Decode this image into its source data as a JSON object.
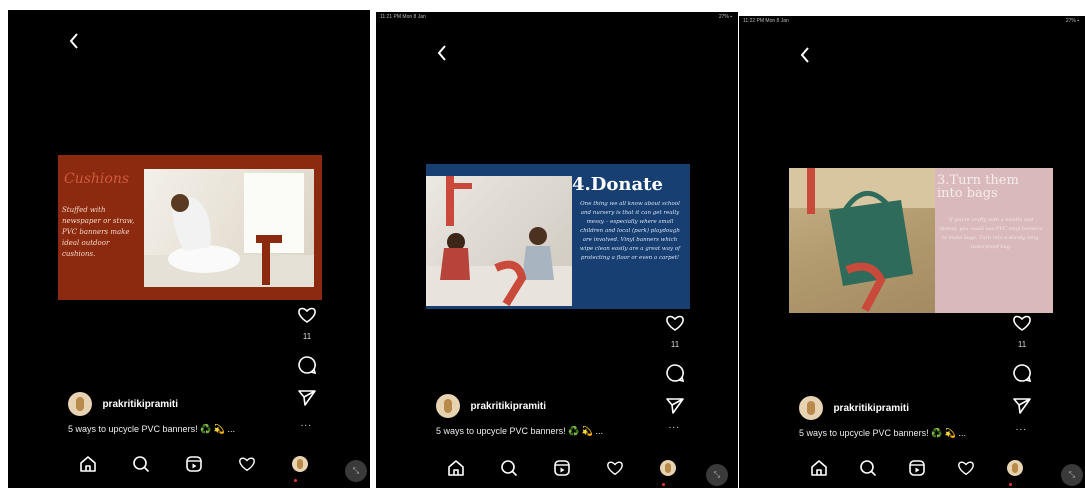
{
  "screens": [
    {
      "status_left": "",
      "status_right": "",
      "slide": {
        "title": "Cushions",
        "text": "Stuffed with newspaper or straw, PVC banners make ideal outdoor cushions."
      },
      "likes": "11",
      "username": "prakritikipramiti",
      "caption": "5 ways to upcycle PVC banners! ♻️ 💫 ...",
      "more": "..."
    },
    {
      "status_left": "11:21 PM  Mon 8 Jan",
      "status_right": "27% ▪",
      "slide": {
        "title": "4.Donate",
        "text": "One thing we all know about school and nursery is that it can get really messy – especially where small children and local (park) playdough are involved. Vinyl banners which wipe clean easily are a great way of protecting a floor or even a carpet!"
      },
      "likes": "11",
      "username": "prakritikipramiti",
      "caption": "5 ways to upcycle PVC banners! ♻️ 💫 ...",
      "more": "..."
    },
    {
      "status_left": "11:22 PM  Mon 8 Jan",
      "status_right": "27% ▪",
      "slide": {
        "title": "3.Turn them into bags",
        "text": "If you're crafty with a needle and thread, you could use PVC vinyl banners to make bags. Turn into a sturdy, long, waterproof bag."
      },
      "likes": "11",
      "username": "prakritikipramiti",
      "caption": "5 ways to upcycle PVC banners! ♻️ 💫 ...",
      "more": "..."
    }
  ],
  "icons": {
    "back": "chevron-left-icon",
    "like": "heart-icon",
    "comment": "comment-bubble-icon",
    "share": "paper-plane-icon",
    "nav": [
      "home-icon",
      "search-icon",
      "reels-icon",
      "activity-heart-icon",
      "profile-avatar"
    ]
  },
  "colors": {
    "background": "#000000",
    "slide1": "#8c2a10",
    "slide2": "#173f72",
    "slide3": "#d9b9b9",
    "notification_dot": "#e33333"
  }
}
